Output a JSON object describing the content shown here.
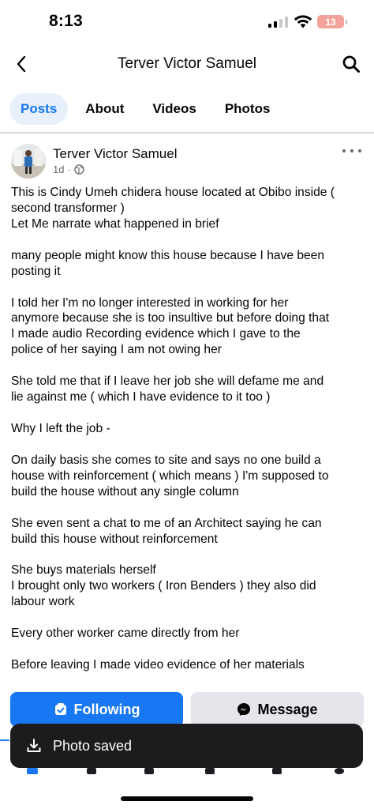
{
  "status_bar": {
    "time": "8:13",
    "battery_level": "13",
    "battery_color": "#f3a39b"
  },
  "header": {
    "title": "Terver Victor Samuel",
    "back_icon": "chevron-left-icon",
    "search_icon": "search-icon"
  },
  "tabs": [
    {
      "label": "Posts",
      "active": true
    },
    {
      "label": "About",
      "active": false
    },
    {
      "label": "Videos",
      "active": false
    },
    {
      "label": "Photos",
      "active": false
    }
  ],
  "post": {
    "author": "Terver Victor Samuel",
    "time": "1d",
    "separator": "·",
    "audience_icon": "globe-icon",
    "paragraphs": [
      "This is Cindy Umeh chidera house located at Obibo inside (\nsecond transformer )\nLet Me narrate what happened in brief",
      " many people might know this house because I have been\nposting it",
      "I told her I'm no longer interested in working for her\nanymore because she is too insultive but before doing that\nI made audio Recording evidence which I gave to the\npolice of her saying I am not owing her",
      "She told me that if I leave her job she will defame me and\nlie against me ( which I have evidence to it too )",
      "Why I left the job -",
      "On daily basis she comes to site and says no one build a\nhouse with reinforcement ( which means ) I'm supposed to\nbuild the house without any single column",
      "She even sent a chat to me of an Architect saying he can\nbuild this house without reinforcement",
      "She buys materials herself\nI brought only two workers ( Iron Benders ) they also did\nlabour work",
      "Every other worker came directly from her",
      "Before leaving I made video evidence of her materials"
    ]
  },
  "actions": {
    "following_label": "Following",
    "message_label": "Message",
    "primary_color": "#1877f2"
  },
  "toast": {
    "label": "Photo saved",
    "icon": "download-icon"
  }
}
